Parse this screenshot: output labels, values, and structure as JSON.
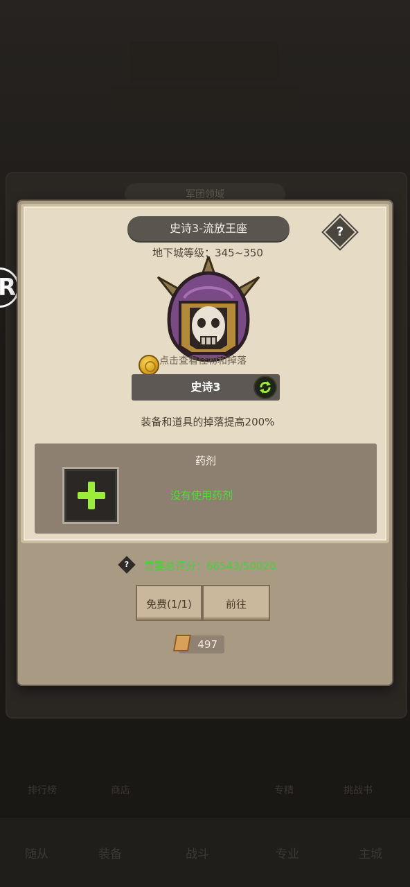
{
  "background": {
    "top_banner": "",
    "bg_tab_label": "军团领域",
    "nav_items": [
      "随从",
      "装备",
      "战斗",
      "专业",
      "主城"
    ],
    "sub_nav_items": [
      "排行榜",
      "商店",
      "专精",
      "挑战书"
    ]
  },
  "side_badge": "R",
  "modal": {
    "title": "史诗3-流放王座",
    "help_label": "?",
    "dungeon_level": "地下城等级：345~350",
    "tap_hint": "点击查看怪物和掉落",
    "difficulty": "史诗3",
    "bonus_text": "装备和道具的掉落提高200%",
    "potion": {
      "title": "药剂",
      "status": "没有使用药剂"
    },
    "score": {
      "help_label": "?",
      "text": "需要总评分：66543/50020"
    },
    "buttons": {
      "free": "免费(1/1)",
      "go": "前往"
    },
    "scroll_count": "497"
  },
  "colors": {
    "accent_green": "#46d337",
    "plus_green": "#9cec3a",
    "parchment": "#e6dcc5"
  }
}
